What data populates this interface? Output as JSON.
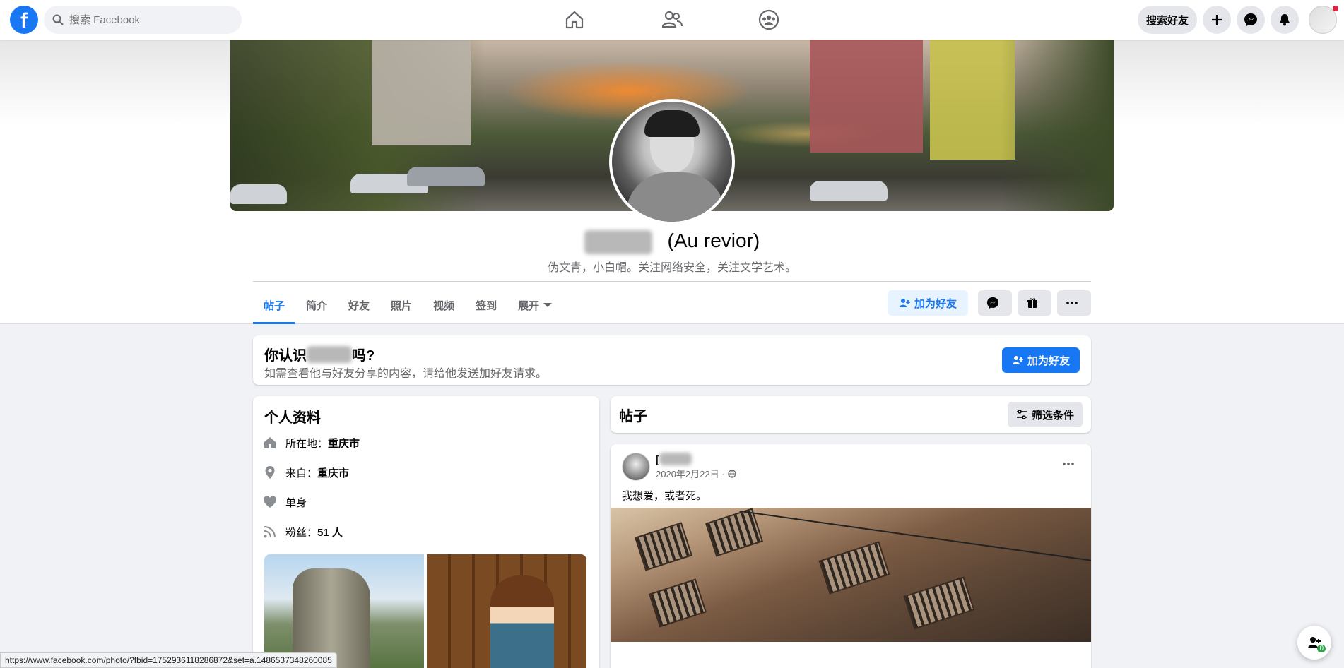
{
  "colors": {
    "brand": "#1877f2",
    "background": "#f0f2f5",
    "text_secondary": "#65676b"
  },
  "topbar": {
    "logo_icon": "facebook-logo-icon",
    "logo_letter": "f",
    "search_placeholder": "搜索 Facebook",
    "nav_icons": [
      "home-icon",
      "friends-icon",
      "groups-icon"
    ],
    "find_friends_label": "搜索好友",
    "create_icon": "plus-icon",
    "messenger_icon": "messenger-icon",
    "notifications_icon": "bell-icon"
  },
  "profile": {
    "name_suffix": "(Au revior)",
    "bio": "伪文青，小白帽。关注网络安全，关注文学艺术。",
    "tabs": [
      "帖子",
      "简介",
      "好友",
      "照片",
      "视频",
      "签到",
      "展开"
    ],
    "active_tab": "帖子",
    "add_friend_label": "加为好友"
  },
  "know_card": {
    "title_prefix": "你认识",
    "title_suffix": "吗?",
    "subtitle": "如需查看他与好友分享的内容，请给他发送加好友请求。",
    "button_label": "加为好友"
  },
  "intro": {
    "title": "个人资料",
    "items": [
      {
        "icon": "home-icon",
        "label": "所在地：",
        "value": "重庆市"
      },
      {
        "icon": "location-pin-icon",
        "label": "来自：",
        "value": "重庆市"
      },
      {
        "icon": "heart-icon",
        "label": "",
        "value": "单身"
      },
      {
        "icon": "rss-icon",
        "label": "粉丝：",
        "value": "51 人"
      }
    ]
  },
  "posts": {
    "title": "帖子",
    "filter_label": "筛选条件",
    "post": {
      "name_visible": "[",
      "date": "2020年2月22日 ·",
      "privacy_icon": "globe-icon",
      "text": "我想爱，或者死。"
    }
  },
  "status_url": "https://www.facebook.com/photo/?fbid=1752936118286872&set=a.1486537348260085",
  "float_badge": "0"
}
